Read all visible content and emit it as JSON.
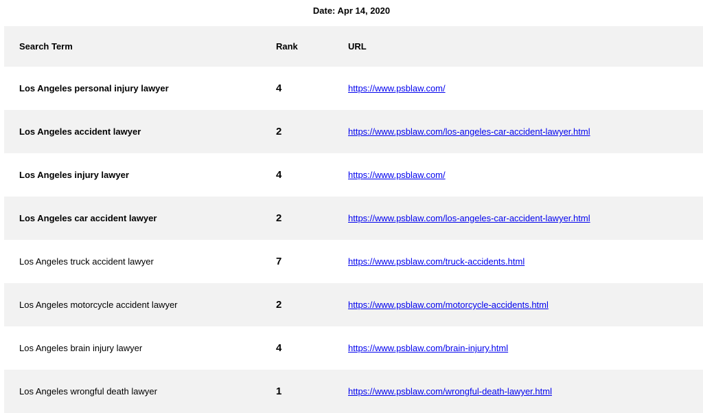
{
  "date_label": "Date: Apr 14, 2020",
  "table": {
    "headers": {
      "term": "Search Term",
      "rank": "Rank",
      "url": "URL"
    },
    "rows": [
      {
        "term": "Los Angeles personal injury lawyer",
        "rank": "4",
        "url": "https://www.psblaw.com/",
        "bold": true
      },
      {
        "term": "Los Angeles accident lawyer",
        "rank": "2",
        "url": "https://www.psblaw.com/los-angeles-car-accident-lawyer.html",
        "bold": true
      },
      {
        "term": "Los Angeles injury lawyer",
        "rank": "4",
        "url": "https://www.psblaw.com/",
        "bold": true
      },
      {
        "term": "Los Angeles car accident lawyer",
        "rank": "2",
        "url": "https://www.psblaw.com/los-angeles-car-accident-lawyer.html",
        "bold": true
      },
      {
        "term": "Los Angeles truck accident lawyer",
        "rank": "7",
        "url": "https://www.psblaw.com/truck-accidents.html",
        "bold": false
      },
      {
        "term": "Los Angeles motorcycle accident lawyer",
        "rank": "2",
        "url": "https://www.psblaw.com/motorcycle-accidents.html",
        "bold": false
      },
      {
        "term": "Los Angeles brain injury lawyer",
        "rank": "4",
        "url": "https://www.psblaw.com/brain-injury.html",
        "bold": false
      },
      {
        "term": "Los Angeles wrongful death lawyer",
        "rank": "1",
        "url": "https://www.psblaw.com/wrongful-death-lawyer.html",
        "bold": false
      }
    ]
  },
  "colors": {
    "row_shade": "#f2f2f2",
    "link": "#0000ee"
  }
}
